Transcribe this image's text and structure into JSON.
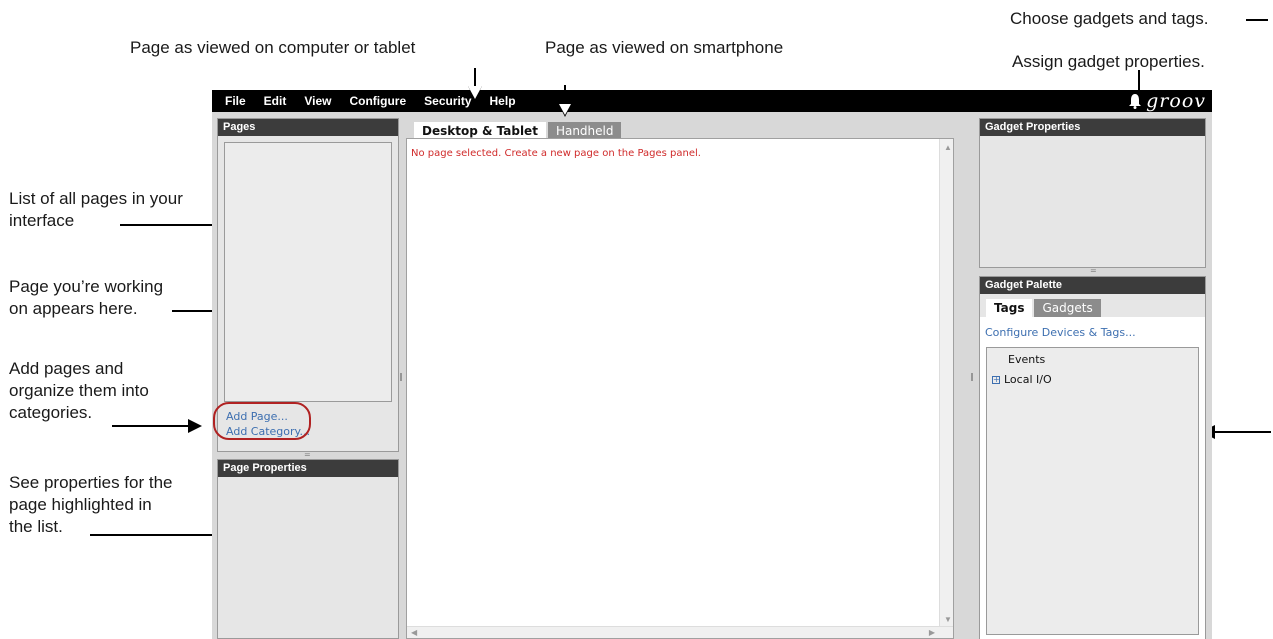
{
  "callouts": {
    "top_left": "Page as viewed on computer or tablet",
    "top_middle": "Page as viewed on smartphone",
    "top_right_1": "Choose gadgets and tags.",
    "top_right_2": "Assign gadget properties.",
    "left_1": "List of all pages in your\ninterface",
    "left_2": "Page you’re working\non appears here.",
    "left_3": "Add pages and\norganize them into\ncategories.",
    "left_4": "See properties for the\npage highlighted in\nthe list."
  },
  "menubar": {
    "items": [
      "File",
      "Edit",
      "View",
      "Configure",
      "Security",
      "Help"
    ],
    "logo": "groov"
  },
  "pages_panel": {
    "title": "Pages",
    "add_page": "Add Page...",
    "add_category": "Add Category..."
  },
  "page_properties": {
    "title": "Page Properties"
  },
  "editor": {
    "tabs": [
      "Desktop & Tablet",
      "Handheld"
    ],
    "message": "No page selected. Create a new page on the Pages panel."
  },
  "gadget_properties": {
    "title": "Gadget Properties"
  },
  "gadget_palette": {
    "title": "Gadget Palette",
    "tabs": [
      "Tags",
      "Gadgets"
    ],
    "configure_link": "Configure Devices & Tags...",
    "tree": {
      "events": "Events",
      "local_io": "Local I/O"
    }
  },
  "colors": {
    "menubar": "#000000",
    "panel_header": "#3c3c3c",
    "link": "#3d6fb0",
    "error_text": "#d02b2b",
    "highlight_oval": "#b02222"
  },
  "icons": [
    "bell-icon",
    "expand-plus-icon"
  ]
}
